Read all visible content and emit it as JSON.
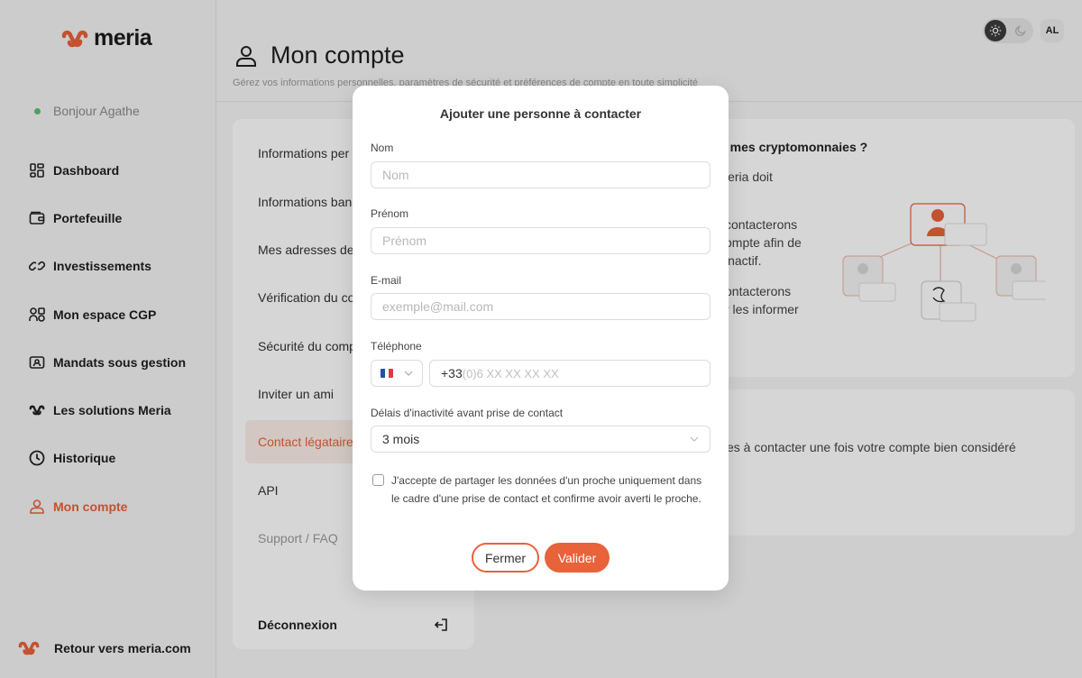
{
  "brand": {
    "name": "meria",
    "accent": "#e8623a"
  },
  "sidebar": {
    "greeting": "Bonjour Agathe",
    "items": [
      {
        "label": "Dashboard",
        "icon": "dashboard-icon"
      },
      {
        "label": "Portefeuille",
        "icon": "wallet-icon"
      },
      {
        "label": "Investissements",
        "icon": "investments-icon"
      },
      {
        "label": "Mon espace CGP",
        "icon": "users-icon"
      },
      {
        "label": "Mandats sous gestion",
        "icon": "mandate-icon"
      },
      {
        "label": "Les solutions Meria",
        "icon": "meria-logo-icon"
      },
      {
        "label": "Historique",
        "icon": "clock-icon"
      },
      {
        "label": "Mon compte",
        "icon": "user-icon",
        "active": true
      }
    ],
    "back_link": "Retour vers meria.com"
  },
  "header": {
    "avatar_initials": "AL",
    "title": "Mon compte",
    "subtitle": "Gérez vos informations personnelles, paramètres de sécurité et préférences de compte en toute simplicité"
  },
  "settings_menu": {
    "items": [
      "Informations per",
      "Informations ban",
      "Mes adresses de",
      "Vérification du co",
      "Sécurité du comp",
      "Inviter un ami",
      "Contact légataire",
      "API",
      "Support / FAQ"
    ],
    "logout": "Déconnexion"
  },
  "info_card": {
    "title": "e mes cryptomonnaies ?",
    "lines": [
      "leria doit",
      "contacterons",
      "ompte afin de",
      "inactif.",
      "ontacterons",
      "r les informer"
    ]
  },
  "info_card2": {
    "text": "es à contacter une fois votre compte bien considéré"
  },
  "modal": {
    "title": "Ajouter une personne à contacter",
    "nom_label": "Nom",
    "nom_placeholder": "Nom",
    "prenom_label": "Prénom",
    "prenom_placeholder": "Prénom",
    "email_label": "E-mail",
    "email_placeholder": "exemple@mail.com",
    "phone_label": "Téléphone",
    "phone_prefix": "+33",
    "phone_placeholder": "(0)6 XX XX XX XX",
    "delay_label": "Délais d'inactivité avant prise de contact",
    "delay_value": "3 mois",
    "consent_text": "J'accepte de partager les données d'un proche uniquement dans le cadre d'une prise de contact  et confirme avoir averti le proche.",
    "close_label": "Fermer",
    "validate_label": "Valider"
  }
}
